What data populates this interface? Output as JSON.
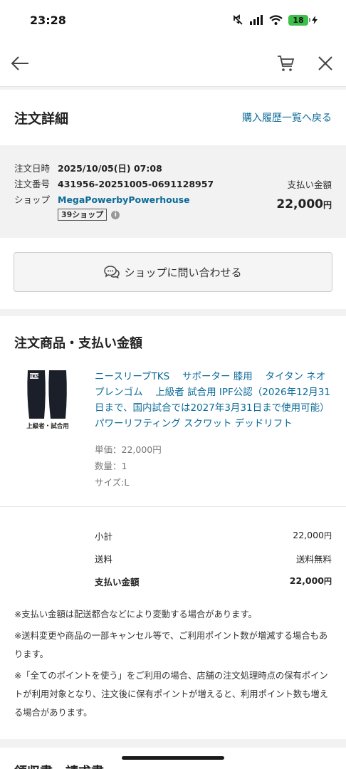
{
  "status_bar": {
    "time": "23:28",
    "battery_level": "18",
    "battery_color": "#3cc04a"
  },
  "nav": {
    "back_icon": "arrow-left-icon",
    "cart_icon": "cart-icon",
    "close_icon": "close-icon"
  },
  "header": {
    "title": "注文詳細",
    "history_link": "購入履歴一覧へ戻る"
  },
  "order": {
    "date_label": "注文日時",
    "date_value": "2025/10/05(日) 07:08",
    "number_label": "注文番号",
    "number_value": "431956-20251005-0691128957",
    "shop_label": "ショップ",
    "shop_value": "MegaPowerbyPowerhouse",
    "shop_badge": "39ショップ",
    "info_icon": "info-icon",
    "payment_label": "支払い金額",
    "payment_value": "22,000",
    "currency": "円"
  },
  "contact": {
    "label": "ショップに問い合わせる",
    "icon": "chat-icon"
  },
  "items_section": {
    "title": "注文商品・支払い金額"
  },
  "product": {
    "name": "ニースリーブTKS　 サポーター 膝用　 タイタン ネオプレンゴム　 上級者 試合用 IPF公認（2026年12月31日まで、国内試合では2027年3月31日まで使用可能） パワーリフティング スクワット デッドリフト",
    "thumb_caption": "上級者・試合用",
    "thumb_logo": "TKS",
    "unit_price": "単価：22,000円",
    "quantity": "数量：1",
    "size": "サイズ:L"
  },
  "totals": {
    "subtotal_label": "小計",
    "subtotal_value": "22,000",
    "currency": "円",
    "shipping_label": "送料",
    "shipping_value": "送料無料",
    "payment_label": "支払い金額",
    "payment_value": "22,000"
  },
  "notes": [
    "※支払い金額は配送都合などにより変動する場合があります。",
    "※送料変更や商品の一部キャンセル等で、ご利用ポイント数が増減する場合もあります。",
    "※「全てのポイントを使う」をご利用の場合、店舗の注文処理時点の保有ポイントが利用対象となり、注文後に保有ポイントが増えると、利用ポイント数も増える場合があります。"
  ],
  "next_section": {
    "title": "領収書・請求書"
  }
}
